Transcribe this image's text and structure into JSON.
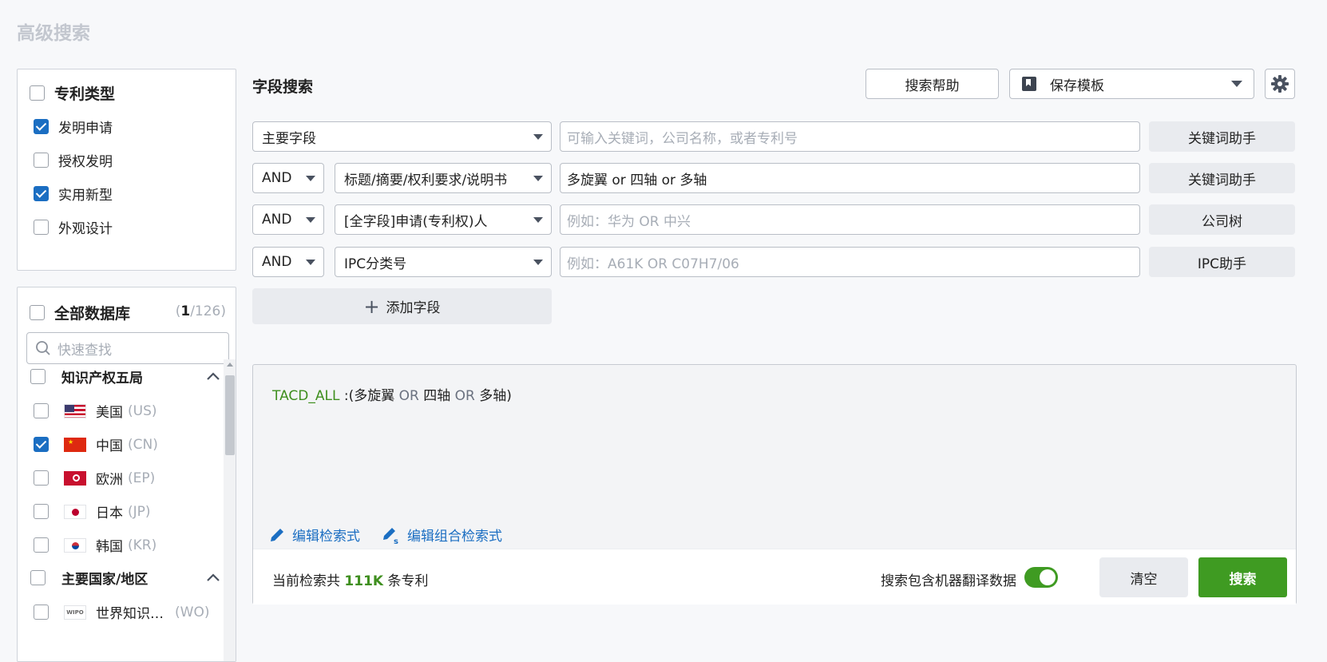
{
  "page": {
    "title": "高级搜索"
  },
  "patent_type": {
    "title": "专利类型",
    "items": [
      {
        "label": "发明申请",
        "checked": true
      },
      {
        "label": "授权发明",
        "checked": false
      },
      {
        "label": "实用新型",
        "checked": true
      },
      {
        "label": "外观设计",
        "checked": false
      }
    ]
  },
  "database": {
    "title": "全部数据库",
    "count_open": "(",
    "count_selected": "1",
    "count_total": "/126)",
    "search_placeholder": "快速查找",
    "groups": [
      {
        "label": "知识产权五局",
        "expanded": true,
        "countries": [
          {
            "name": "美国",
            "code": "(US)",
            "checked": false
          },
          {
            "name": "中国",
            "code": "(CN)",
            "checked": true
          },
          {
            "name": "欧洲",
            "code": "(EP)",
            "checked": false
          },
          {
            "name": "日本",
            "code": "(JP)",
            "checked": false
          },
          {
            "name": "韩国",
            "code": "(KR)",
            "checked": false
          }
        ]
      },
      {
        "label": "主要国家/地区",
        "expanded": true,
        "countries": [
          {
            "name": "世界知识…",
            "code": "(WO)",
            "checked": false
          }
        ]
      }
    ]
  },
  "field_search": {
    "title": "字段搜索",
    "help_label": "搜索帮助",
    "template_label": "保存模板",
    "settings_icon": "gear-icon",
    "rows": [
      {
        "operator": "",
        "field": "主要字段",
        "value": "",
        "placeholder": "可输入关键词，公司名称，或者专利号",
        "helper": "关键词助手"
      },
      {
        "operator": "AND",
        "field": "标题/摘要/权利要求/说明书",
        "value": "多旋翼 or 四轴 or 多轴",
        "placeholder": "",
        "helper": "关键词助手"
      },
      {
        "operator": "AND",
        "field": "[全字段]申请(专利权)人",
        "value": "",
        "placeholder": "例如：华为 OR 中兴",
        "helper": "公司树"
      },
      {
        "operator": "AND",
        "field": "IPC分类号",
        "value": "",
        "placeholder": "例如：A61K OR C07H7/06",
        "helper": "IPC助手"
      }
    ],
    "add_field_label": "添加字段"
  },
  "query": {
    "field_code": "TACD_ALL",
    "part_open": " :(多旋翼 ",
    "op1": "OR",
    "part_mid": " 四轴 ",
    "op2": "OR",
    "part_end": " 多轴)",
    "edit_label": "编辑检索式",
    "edit_combo_label": "编辑组合检索式",
    "count_prefix": "当前检索共 ",
    "count_value": "111K",
    "count_suffix": " 条专利",
    "machine_translation_label": "搜索包含机器翻译数据",
    "machine_translation_on": true,
    "clear_label": "清空",
    "search_label": "搜索"
  },
  "colors": {
    "accent_green": "#3f9b22",
    "link_blue": "#1b6ec2"
  }
}
